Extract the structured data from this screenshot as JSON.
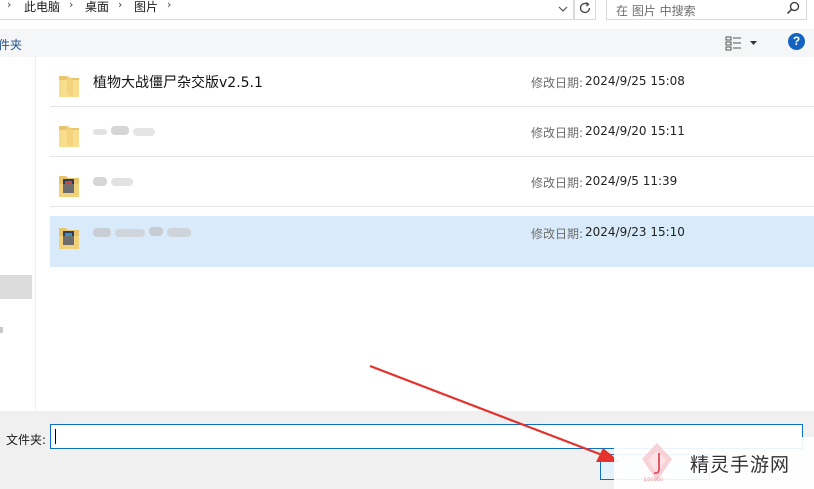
{
  "address_bar": {
    "breadcrumbs": [
      "此电脑",
      "桌面",
      "图片"
    ],
    "search_placeholder": "在 图片 中搜索"
  },
  "command_bar": {
    "new_folder_label": "件夹",
    "help_label": "?"
  },
  "file_list": {
    "rows": [
      {
        "name": "植物大战僵尸杂交版v2.5.1",
        "date_label": "修改日期:",
        "date_value": "2024/9/25 15:08",
        "icon": "folder-icon",
        "blurred": false,
        "selected": false
      },
      {
        "name": "",
        "date_label": "修改日期:",
        "date_value": "2024/9/20 15:11",
        "icon": "folder-icon",
        "blurred": true,
        "selected": false
      },
      {
        "name": "",
        "date_label": "修改日期:",
        "date_value": "2024/9/5 11:39",
        "icon": "image-folder-icon",
        "blurred": true,
        "selected": false
      },
      {
        "name": "",
        "date_label": "修改日期:",
        "date_value": "2024/9/23 15:10",
        "icon": "image-folder-icon",
        "blurred": true,
        "selected": true
      }
    ]
  },
  "bottom_bar": {
    "folder_label": "文件夹:",
    "folder_value": ""
  },
  "watermark": {
    "text": "精灵手游网",
    "sub": "JLDOUOU"
  },
  "colors": {
    "accent": "#0f6fc6",
    "selected_row": "#d9ebfa",
    "arrow": "#e5322d"
  }
}
